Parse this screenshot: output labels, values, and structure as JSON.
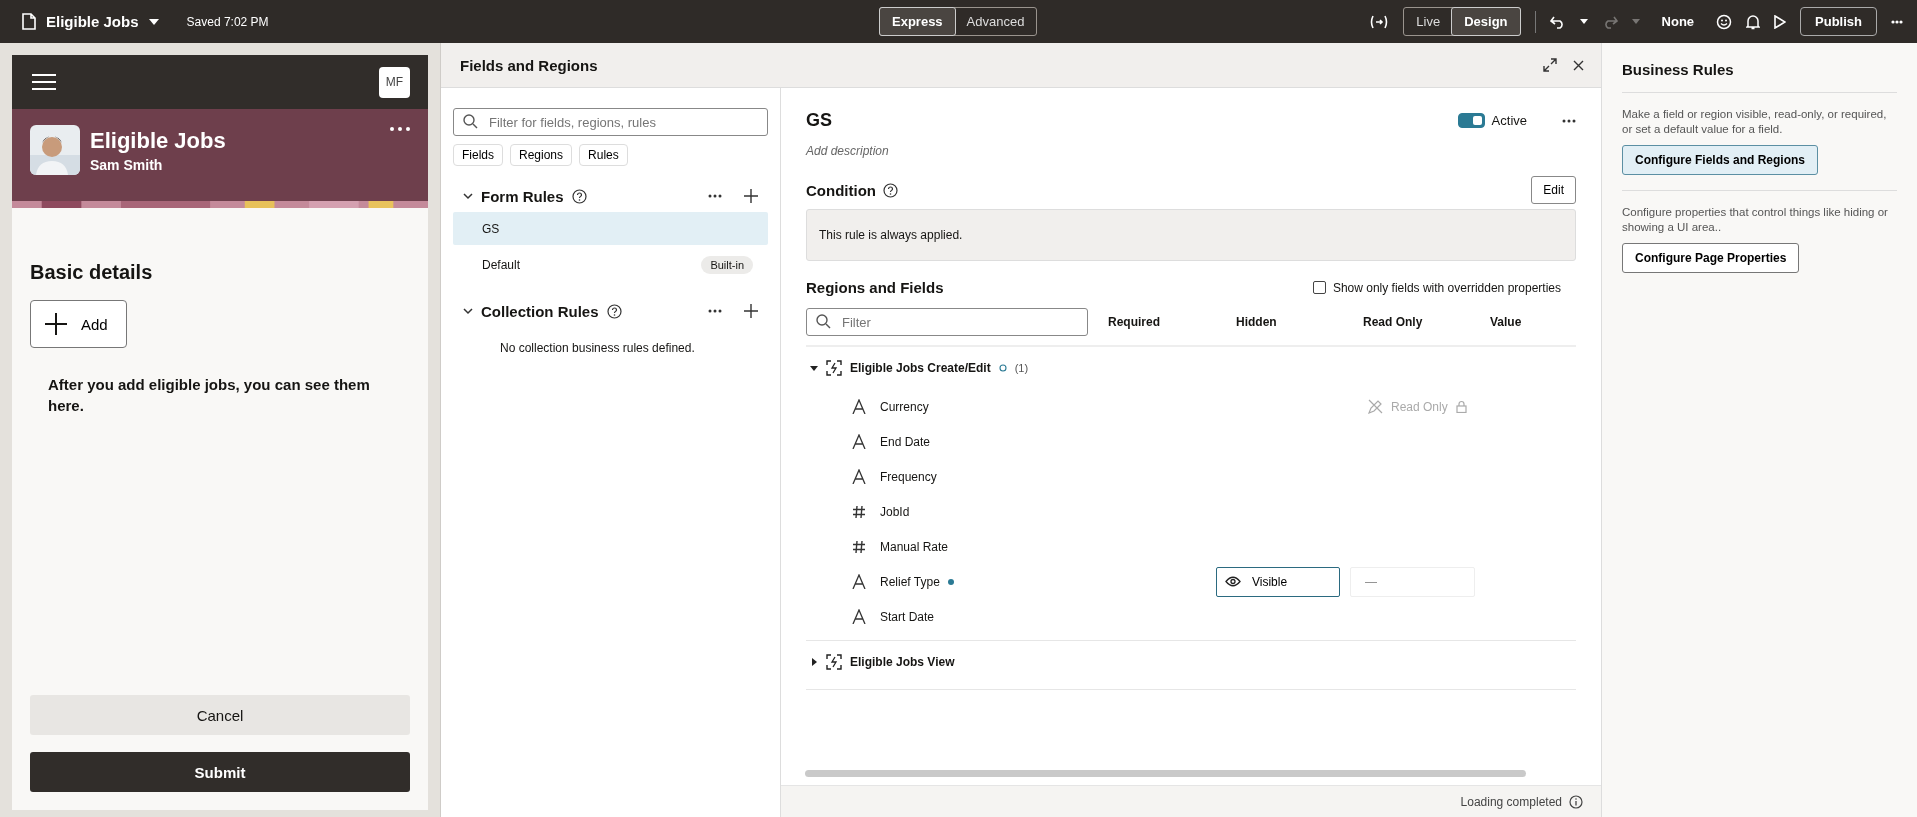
{
  "app_bar": {
    "title": "Eligible Jobs",
    "saved": "Saved 7:02 PM",
    "modes": [
      {
        "label": "Express",
        "selected": true
      },
      {
        "label": "Advanced",
        "selected": false
      }
    ],
    "view_modes": [
      {
        "label": "Live",
        "selected": false
      },
      {
        "label": "Design",
        "selected": true
      }
    ],
    "redo_disabled": true,
    "theme": "None",
    "publish": "Publish"
  },
  "preview": {
    "avatar": "MF",
    "title": "Eligible Jobs",
    "subtitle": "Sam Smith",
    "section": "Basic details",
    "add_button": "Add",
    "empty_message": "After you add eligible jobs, you can see them here.",
    "buttons": [
      {
        "label": "Cancel",
        "kind": "secondary"
      },
      {
        "label": "Submit",
        "kind": "primary"
      }
    ]
  },
  "fields_panel": {
    "title": "Fields and Regions",
    "filter_placeholder": "Filter for fields, regions, rules",
    "filter_chips": [
      "Fields",
      "Regions",
      "Rules"
    ],
    "groups": [
      {
        "title": "Form Rules",
        "expanded": true,
        "rules": [
          {
            "name": "GS",
            "selected": true
          },
          {
            "name": "Default",
            "selected": false,
            "badge": "Built-in"
          }
        ]
      },
      {
        "title": "Collection Rules",
        "expanded": true,
        "empty_message": "No collection business rules defined."
      }
    ]
  },
  "rule": {
    "name": "GS",
    "active": true,
    "active_label": "Active",
    "description_placeholder": "Add description",
    "condition_title": "Condition",
    "edit_button": "Edit",
    "condition_text": "This rule is always applied.",
    "regions_title": "Regions and Fields",
    "override_filter": {
      "label": "Show only fields with overridden properties",
      "checked": false
    },
    "filter_placeholder": "Filter",
    "columns": [
      "Required",
      "Hidden",
      "Read Only",
      "Value"
    ],
    "regions": [
      {
        "name": "Eligible Jobs Create/Edit",
        "expanded": true,
        "count": "(1)",
        "fields": [
          {
            "name": "Currency",
            "kind": "text",
            "modified": false,
            "read_only_note": "Read Only"
          },
          {
            "name": "End Date",
            "kind": "text",
            "modified": false
          },
          {
            "name": "Frequency",
            "kind": "text",
            "modified": false
          },
          {
            "name": "JobId",
            "kind": "number",
            "modified": false
          },
          {
            "name": "Manual Rate",
            "kind": "number",
            "modified": false
          },
          {
            "name": "Relief Type",
            "kind": "text",
            "modified": true,
            "hidden_value": "Visible",
            "read_only_value": "—"
          },
          {
            "name": "Start Date",
            "kind": "text",
            "modified": false
          }
        ]
      },
      {
        "name": "Eligible Jobs View",
        "expanded": false
      }
    ]
  },
  "status": "Loading completed",
  "business_rules": {
    "title": "Business Rules",
    "sections": [
      {
        "description": "Make a field or region visible, read-only, or required, or set a default value for a field.",
        "button": "Configure Fields and Regions",
        "selected": true
      },
      {
        "description": "Configure properties that control things like hiding or showing a UI area..",
        "button": "Configure Page Properties",
        "selected": false
      }
    ]
  }
}
